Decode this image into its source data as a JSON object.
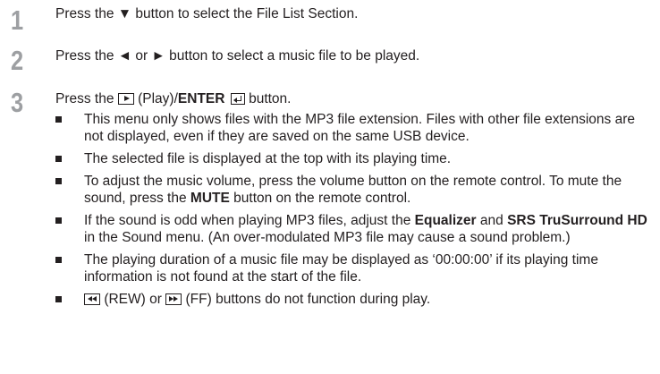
{
  "steps": [
    {
      "number": "1",
      "text": "Press the ▼ button to select the File List Section."
    },
    {
      "number": "2",
      "text": "Press the ◄ or ► button to select a music file to be played."
    },
    {
      "number": "3",
      "text_before": "Press the",
      "play_text": "(Play)/",
      "enter_label": "ENTER",
      "text_after": "button."
    }
  ],
  "notes": {
    "note1": "This menu only shows files with the MP3 file extension. Files with other file extensions are not displayed, even if they are saved on the same USB device.",
    "note2": "The selected file is displayed at the top with its playing time.",
    "note3": {
      "part1": "To adjust the music volume, press the volume button on the remote control. To mute the sound, press the",
      "bold1": "MUTE",
      "part2": "button on the remote control."
    },
    "note4": {
      "part1": "If the sound is odd when playing MP3 files, adjust the",
      "bold1": "Equalizer",
      "part2": "and",
      "bold2": "SRS TruSurround HD",
      "part3": "in the Sound menu. (An over-modulated MP3 file may cause a sound problem.)"
    },
    "note5": "The playing duration of a music file may be displayed as ‘00:00:00’ if its playing time information is not found at the start of the file.",
    "note6": {
      "rew_text": "(REW) or",
      "ff_text": "(FF) buttons do not function during play."
    }
  },
  "icons": {
    "play": "play-button-icon",
    "enter": "enter-return-icon",
    "rew": "rewind-button-icon",
    "ff": "fast-forward-button-icon"
  }
}
